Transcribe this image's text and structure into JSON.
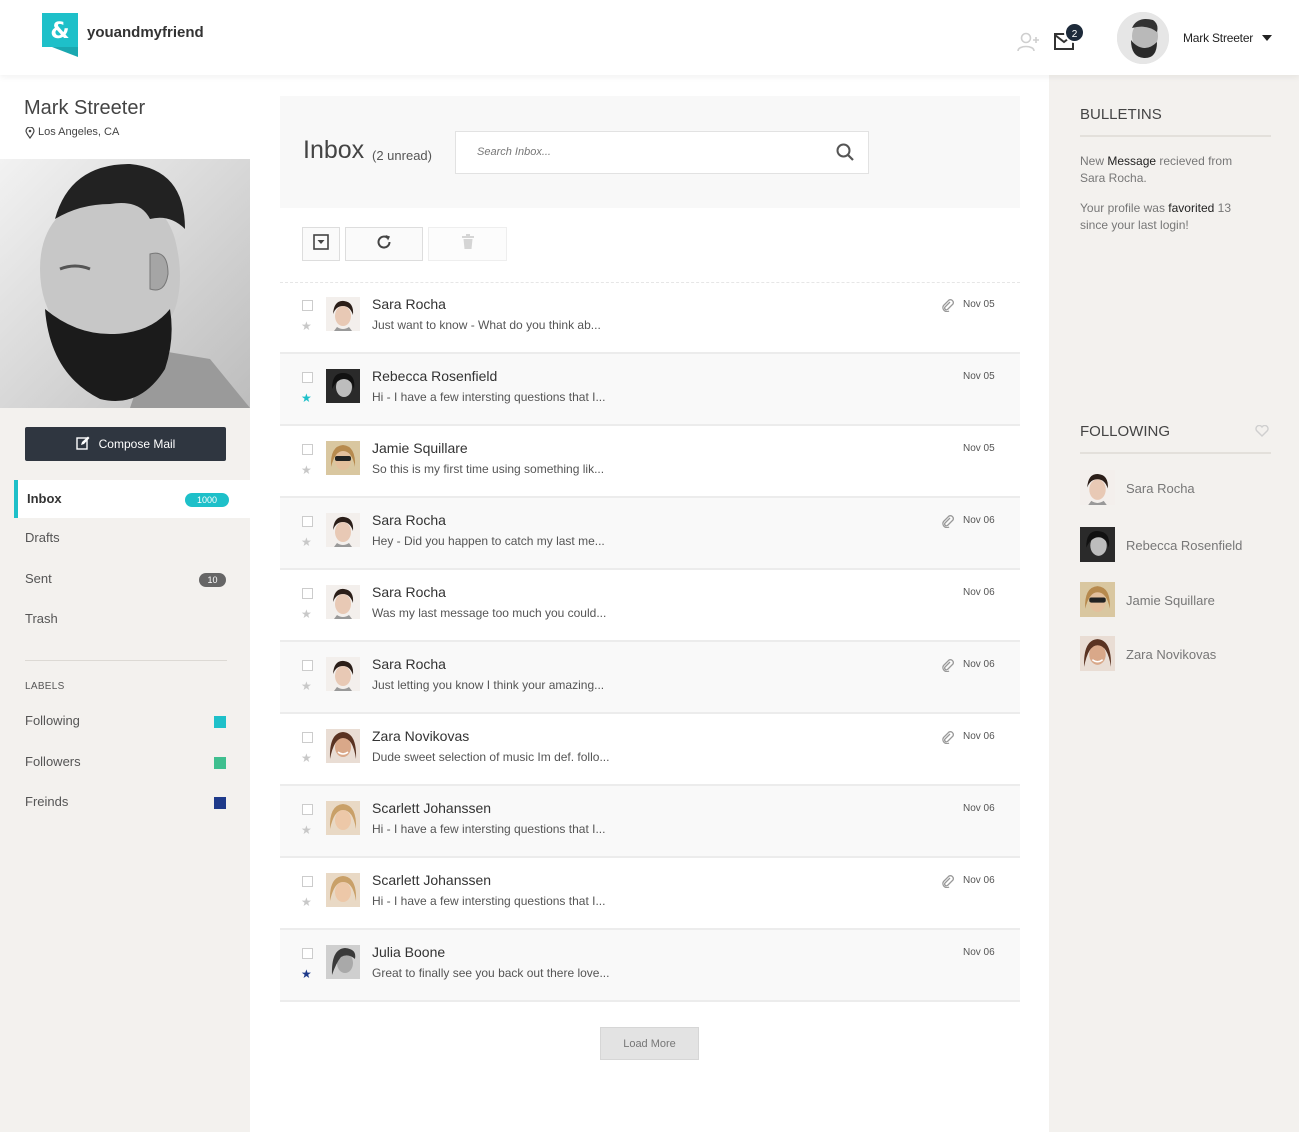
{
  "header": {
    "brand": "youandmyfriend",
    "mail_count": "2",
    "user_name": "Mark Streeter"
  },
  "profile": {
    "name": "Mark Streeter",
    "location": "Los Angeles, CA"
  },
  "sidebar": {
    "compose_label": "Compose Mail",
    "nav": [
      {
        "label": "Inbox",
        "badge": "1000"
      },
      {
        "label": "Drafts",
        "badge": ""
      },
      {
        "label": "Sent",
        "badge": "10"
      },
      {
        "label": "Trash",
        "badge": ""
      }
    ],
    "labels_heading": "LABELS",
    "labels": [
      {
        "label": "Following",
        "color": "#1ec0c9"
      },
      {
        "label": "Followers",
        "color": "#3fbf8f"
      },
      {
        "label": "Freinds",
        "color": "#1e3a8a"
      }
    ]
  },
  "inbox": {
    "title": "Inbox",
    "unread": "(2 unread)",
    "search_placeholder": "Search Inbox...",
    "load_more": "Load More",
    "messages": [
      {
        "sender": "Sara Rocha",
        "snippet": "Just want to know - What do you think ab...",
        "date": "Nov 05",
        "attachment": true,
        "starred": "none"
      },
      {
        "sender": "Rebecca Rosenfield",
        "snippet": "Hi - I have a few intersting questions that I...",
        "date": "Nov 05",
        "attachment": false,
        "starred": "teal"
      },
      {
        "sender": "Jamie Squillare",
        "snippet": "So this is my first time using something lik...",
        "date": "Nov 05",
        "attachment": false,
        "starred": "none"
      },
      {
        "sender": "Sara Rocha",
        "snippet": "Hey -  Did you happen to catch my last me...",
        "date": "Nov 06",
        "attachment": true,
        "starred": "none"
      },
      {
        "sender": "Sara Rocha",
        "snippet": "Was my last message too much you could...",
        "date": "Nov 06",
        "attachment": false,
        "starred": "none"
      },
      {
        "sender": "Sara Rocha",
        "snippet": "Just letting you know I think your amazing...",
        "date": "Nov 06",
        "attachment": true,
        "starred": "none"
      },
      {
        "sender": "Zara Novikovas",
        "snippet": "Dude sweet selection of music Im def. follo...",
        "date": "Nov 06",
        "attachment": true,
        "starred": "none"
      },
      {
        "sender": "Scarlett Johanssen",
        "snippet": "Hi - I have a few intersting questions that I...",
        "date": "Nov 06",
        "attachment": false,
        "starred": "none"
      },
      {
        "sender": "Scarlett Johanssen",
        "snippet": "Hi - I have a few intersting questions that I...",
        "date": "Nov 06",
        "attachment": true,
        "starred": "none"
      },
      {
        "sender": "Julia Boone",
        "snippet": "Great to finally see you back out there love...",
        "date": "Nov 06",
        "attachment": false,
        "starred": "navy"
      }
    ]
  },
  "bulletins": {
    "title": "BULLETINS",
    "item1": {
      "pre": "New ",
      "strong": "Message",
      "post": " recieved from Sara Rocha."
    },
    "item2": {
      "pre": "Your profile was ",
      "strong": "favorited",
      "post": " 13 since your last login!"
    }
  },
  "following": {
    "title": "FOLLOWING",
    "people": [
      "Sara Rocha",
      "Rebecca Rosenfield",
      "Jamie Squillare",
      "Zara Novikovas"
    ]
  },
  "colors": {
    "accent": "#1ec0c9",
    "dark": "#2f3640",
    "panel": "#f3f1ee"
  }
}
